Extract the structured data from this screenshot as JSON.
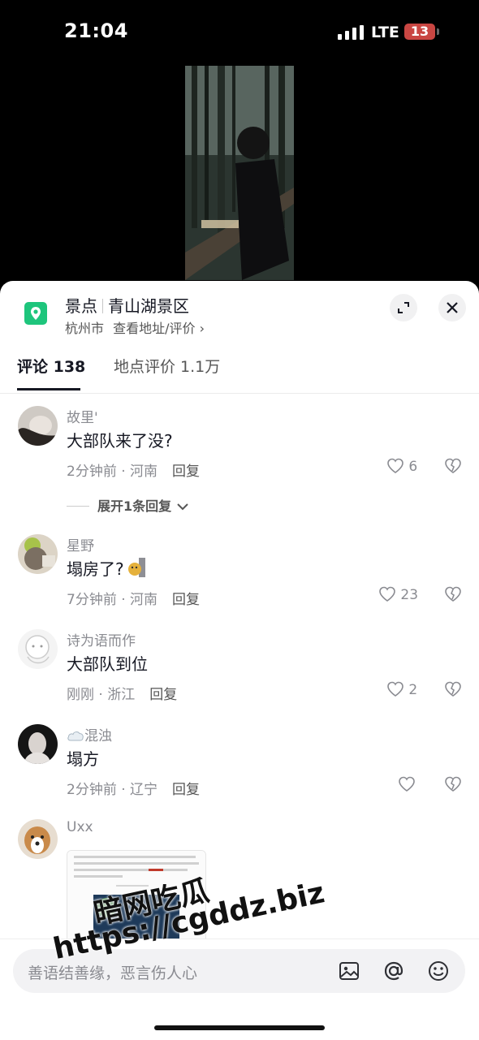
{
  "status_bar": {
    "time": "21:04",
    "network": "LTE",
    "battery": "13"
  },
  "location": {
    "category": "景点",
    "name": "青山湖景区",
    "city": "杭州市",
    "view_link": "查看地址/评价 ›"
  },
  "tabs": [
    {
      "label": "评论 138",
      "active": true
    },
    {
      "label": "地点评价 1.1万",
      "active": false
    }
  ],
  "comments": [
    {
      "user": "故里'",
      "text": "大部队来了没?",
      "time": "2分钟前",
      "region": "河南",
      "reply": "回复",
      "likes": "6"
    },
    {
      "user": "星野",
      "text": "塌房了?",
      "time": "7分钟前",
      "region": "河南",
      "reply": "回复",
      "likes": "23"
    },
    {
      "user": "诗为语而作",
      "text": "大部队到位",
      "time": "刚刚",
      "region": "浙江",
      "reply": "回复",
      "likes": "2"
    },
    {
      "user": "混浊",
      "text": "塌方",
      "time": "2分钟前",
      "region": "辽宁",
      "reply": "回复",
      "likes": ""
    },
    {
      "user": "Uxx"
    }
  ],
  "expand_replies": "展开1条回复",
  "input": {
    "placeholder": "善语结善缘，恶言伤人心"
  },
  "watermark": {
    "line1": "暗网吃瓜",
    "line2": "https://cgddz.biz"
  }
}
